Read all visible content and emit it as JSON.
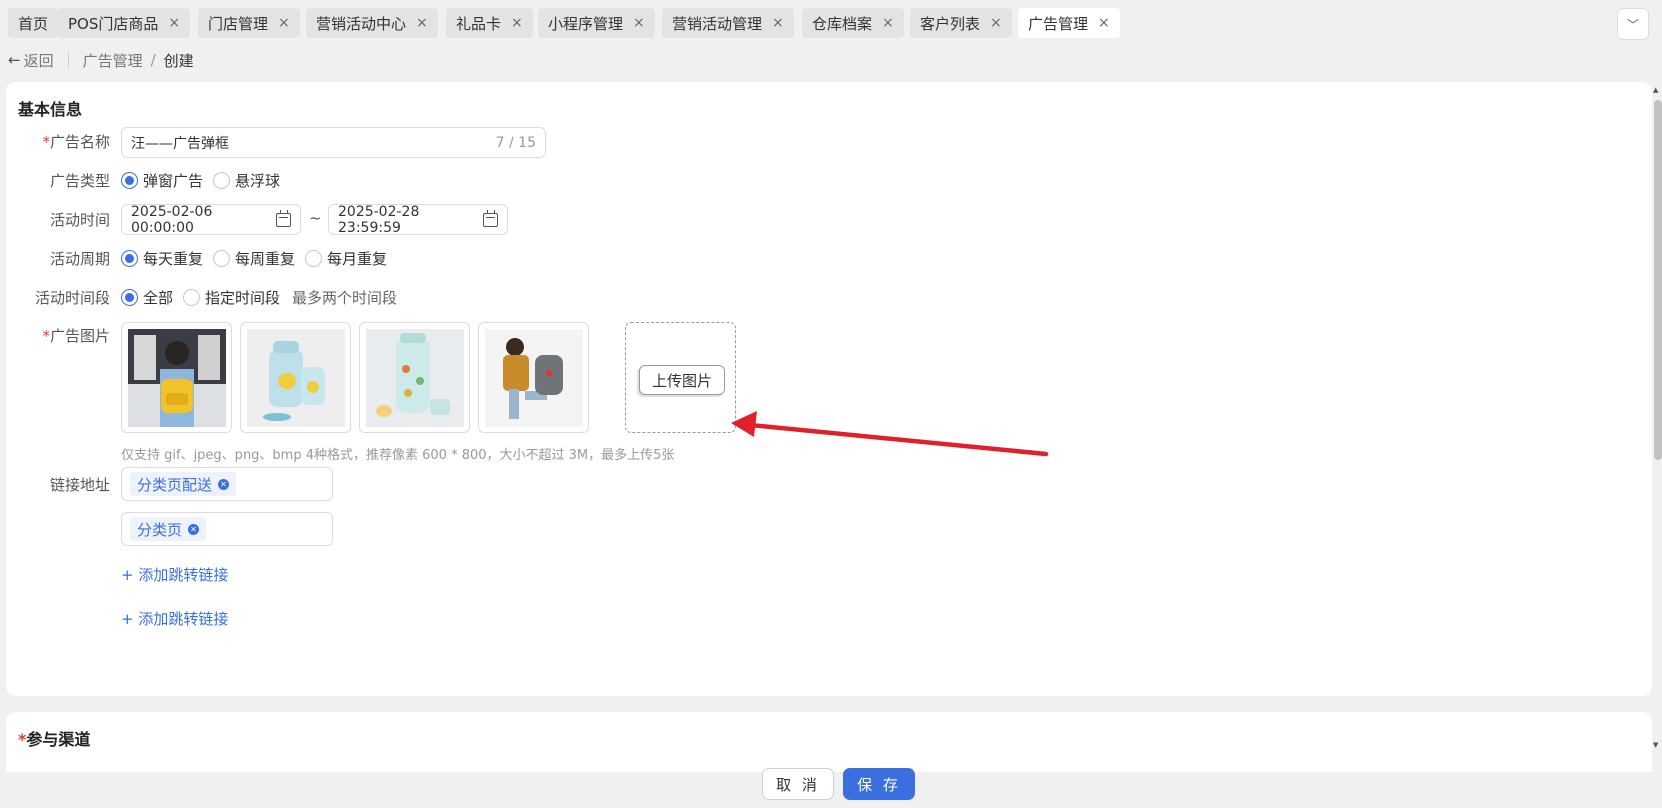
{
  "tabs": [
    {
      "label": "首页",
      "closable": false,
      "active": false
    },
    {
      "label": "POS门店商品",
      "closable": true,
      "active": false
    },
    {
      "label": "门店管理",
      "closable": true,
      "active": false
    },
    {
      "label": "营销活动中心",
      "closable": true,
      "active": false
    },
    {
      "label": "礼品卡",
      "closable": true,
      "active": false
    },
    {
      "label": "小程序管理",
      "closable": true,
      "active": false
    },
    {
      "label": "营销活动管理",
      "closable": true,
      "active": false
    },
    {
      "label": "仓库档案",
      "closable": true,
      "active": false
    },
    {
      "label": "客户列表",
      "closable": true,
      "active": false
    },
    {
      "label": "广告管理",
      "closable": true,
      "active": true
    }
  ],
  "tab_close_glyph": "×",
  "tab_more_glyph": "﹀",
  "breadcrumb": {
    "back_label": "返回",
    "parent": "广告管理",
    "separator": "/",
    "current": "创建"
  },
  "basic_info": {
    "title": "基本信息",
    "required_mark": "*",
    "name": {
      "label": "广告名称",
      "value": "汪——广告弹框",
      "count": "7 / 15"
    },
    "type": {
      "label": "广告类型",
      "options": [
        "弹窗广告",
        "悬浮球"
      ],
      "selected": "弹窗广告"
    },
    "time": {
      "label": "活动时间",
      "start": "2025-02-06 00:00:00",
      "separator": "~",
      "end": "2025-02-28 23:59:59"
    },
    "cycle": {
      "label": "活动周期",
      "options": [
        "每天重复",
        "每周重复",
        "每月重复"
      ],
      "selected": "每天重复"
    },
    "period": {
      "label": "活动时间段",
      "options": [
        "全部",
        "指定时间段"
      ],
      "selected": "全部",
      "hint": "最多两个时间段"
    },
    "images": {
      "label": "广告图片",
      "thumbnails": [
        "yellow-backpack-photo",
        "kids-cup-photo",
        "thermos-bottle-photo",
        "grey-backpack-photo"
      ],
      "upload_label": "上传图片",
      "tip": "仅支持 gif、jpeg、png、bmp 4种格式，推荐像素 600 * 800，大小不超过 3M，最多上传5张"
    },
    "link": {
      "label": "链接地址",
      "tags": [
        "分类页配送",
        "分类页"
      ],
      "add_label": "+ 添加跳转链接"
    }
  },
  "channel": {
    "title": "参与渠道"
  },
  "footer": {
    "cancel": "取 消",
    "save": "保 存"
  },
  "colors": {
    "accent": "#3b6fe0",
    "required": "#e53935",
    "annotation_arrow": "#e0202a"
  }
}
